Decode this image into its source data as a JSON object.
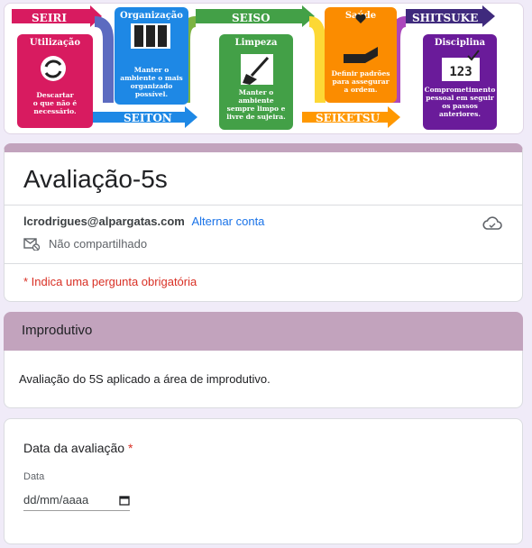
{
  "banner": {
    "steps": [
      {
        "name": "SEIRI",
        "label": "Utilização",
        "desc": [
          "Descartar",
          "o que não é",
          "necessário."
        ]
      },
      {
        "name": "SEITON",
        "label": "Organização",
        "desc": [
          "Manter o",
          "ambiente o mais",
          "organizado",
          "possível."
        ]
      },
      {
        "name": "SEISO",
        "label": "Limpeza",
        "desc": [
          "Manter o",
          "ambiente",
          "sempre limpo e",
          "livre de sujeira."
        ]
      },
      {
        "name": "SEIKETSU",
        "label": "Saúde",
        "desc": [
          "Definir padrões",
          "para assegurar",
          "a ordem."
        ]
      },
      {
        "name": "SHITSUKE",
        "label": "Disciplina",
        "desc": [
          "Comprometimento",
          "pessoal em seguir",
          "os passos",
          "anteriores."
        ]
      }
    ],
    "number_text": "123",
    "colors": {
      "seiri": "#d81b60",
      "seiton": "#1e88e5",
      "seiso": "#43a047",
      "seiketsu": "#ff9800",
      "shitsuke": "#6a1b9a"
    }
  },
  "form": {
    "title": "Avaliação-5s",
    "account_email": "lcrodrigues@alpargatas.com",
    "switch_account": "Alternar conta",
    "shared_status": "Não compartilhado",
    "required_note": "* Indica uma pergunta obrigatória"
  },
  "section": {
    "title": "Improdutivo",
    "description": "Avaliação do 5S aplicado a área de improdutivo."
  },
  "question": {
    "title": "Data da avaliação",
    "required_mark": "*",
    "sublabel": "Data",
    "placeholder": "dd/mm/aaaa"
  },
  "theme": {
    "accent": "#c2a3bd",
    "background": "#f0ebf8",
    "link": "#1a73e8",
    "required": "#d93025"
  }
}
